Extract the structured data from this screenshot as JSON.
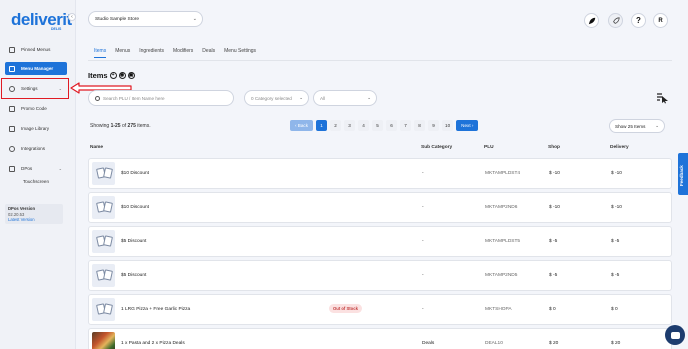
{
  "brand": {
    "logo": "deliverit",
    "sub": "DELIS"
  },
  "sidebar": {
    "collapse": "‹",
    "items": [
      {
        "label": "Pinned Menus"
      },
      {
        "label": "Menu Manager"
      },
      {
        "label": "Settings",
        "chevron": "⌄"
      },
      {
        "label": "Promo Code"
      },
      {
        "label": "Image Library"
      },
      {
        "label": "Integrations"
      },
      {
        "label": "DPos",
        "chevron": "⌄"
      }
    ],
    "sub_items": [
      "Touchscreen"
    ],
    "version": {
      "title": "DPos Version",
      "number": "02.20.53",
      "latest": "Latest Version"
    }
  },
  "header": {
    "store": "Studio Sample Store",
    "store_chevron": "⌄",
    "avatar": "R",
    "help": "?"
  },
  "tabs": [
    "Items",
    "Menus",
    "Ingredients",
    "Modifiers",
    "Deals",
    "Menu Settings"
  ],
  "section": {
    "title": "Items",
    "icons": [
      "+",
      "◉",
      "▣"
    ]
  },
  "filters": {
    "search_placeholder": "Search PLU / Item Name here",
    "category": "0 Category selected",
    "all": "All",
    "chevron": "⌄"
  },
  "pagination": {
    "showing_pre": "Showing ",
    "showing_range": "1-25",
    "showing_mid": " of ",
    "showing_total": "275",
    "showing_post": " items.",
    "back": "‹ Back",
    "pages": [
      "1",
      "2",
      "3",
      "4",
      "5",
      "6",
      "7",
      "8",
      "9",
      "10"
    ],
    "next": "Next ›",
    "show": "Show 25 Items"
  },
  "table": {
    "headers": [
      "Name",
      "Sub Category",
      "PLU",
      "Shop",
      "Delivery"
    ],
    "rows": [
      {
        "name": "$10 Discount",
        "sub": "-",
        "plu": "MKTAMPLDST4",
        "shop": "$ -10",
        "delivery": "$ -10",
        "badge": ""
      },
      {
        "name": "$10 Discount",
        "sub": "-",
        "plu": "MKTAMP2ND6",
        "shop": "$ -10",
        "delivery": "$ -10",
        "badge": ""
      },
      {
        "name": "$5 Discount",
        "sub": "-",
        "plu": "MKTAMPLDST5",
        "shop": "$ -5",
        "delivery": "$ -5",
        "badge": ""
      },
      {
        "name": "$5 Discount",
        "sub": "-",
        "plu": "MKTAMP2ND5",
        "shop": "$ -5",
        "delivery": "$ -5",
        "badge": ""
      },
      {
        "name": "1 LRG Pizza + Free Garlic Pizza",
        "sub": "-",
        "plu": "MKTSHOPA",
        "shop": "$ 0",
        "delivery": "$ 0",
        "badge": "Out of Stock"
      },
      {
        "name": "1 x Pasta and 2 x Pizza Deals",
        "sub": "Deals",
        "plu": "DEAL10",
        "shop": "$ 20",
        "delivery": "$ 20",
        "badge": ""
      }
    ]
  },
  "feedback": "Feedback",
  "colors": {
    "accent": "#1e73d9",
    "highlight": "#e01b24"
  }
}
